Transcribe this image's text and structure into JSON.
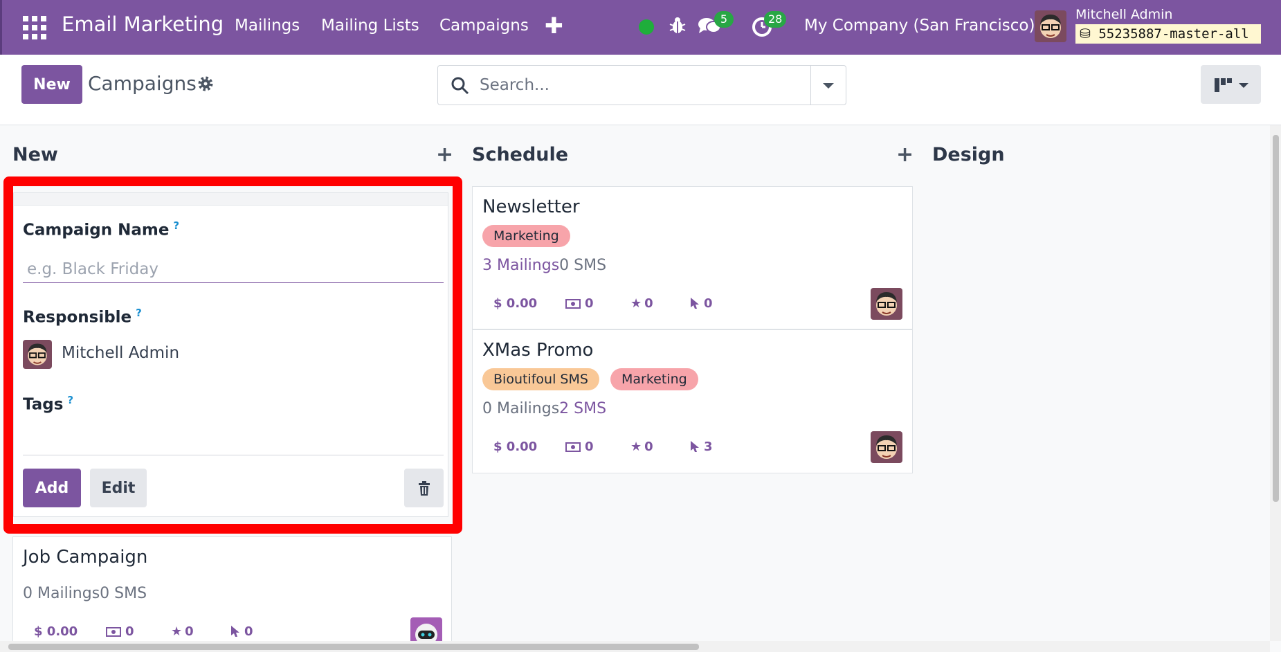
{
  "navbar": {
    "brand": "Email Marketing",
    "menu": [
      "Mailings",
      "Mailing Lists",
      "Campaigns"
    ],
    "chat_count": "5",
    "activity_count": "28",
    "company": "My Company (San Francisco)",
    "user_name": "Mitchell Admin",
    "database": "55235887-master-all",
    "colors": {
      "brand": "#7c55a0",
      "online": "#1fae3b",
      "badge": "#28a745"
    }
  },
  "control": {
    "new_label": "New",
    "breadcrumb": "Campaigns",
    "search_placeholder": "Search..."
  },
  "columns": [
    {
      "title": "New"
    },
    {
      "title": "Schedule"
    },
    {
      "title": "Design"
    }
  ],
  "quick_create": {
    "name_label": "Campaign Name",
    "name_placeholder": "e.g. Black Friday",
    "help_mark": "?",
    "responsible_label": "Responsible",
    "responsible_value": "Mitchell Admin",
    "tags_label": "Tags",
    "add_label": "Add",
    "edit_label": "Edit"
  },
  "cards": [
    {
      "title": "Job Campaign",
      "mailings": "0 Mailings",
      "sms": "0 SMS",
      "revenue": "$ 0.00",
      "quotations": "0",
      "opportunities": "0",
      "clicks": "0"
    },
    {
      "title": "Newsletter",
      "tags": [
        "Marketing"
      ],
      "mailings": "3 Mailings",
      "sms": "0 SMS",
      "revenue": "$ 0.00",
      "quotations": "0",
      "opportunities": "0",
      "clicks": "0"
    },
    {
      "title": "XMas Promo",
      "tags": [
        "Bioutifoul SMS",
        "Marketing"
      ],
      "mailings": "0 Mailings",
      "sms": "2 SMS",
      "revenue": "$ 0.00",
      "quotations": "0",
      "opportunities": "0",
      "clicks": "3"
    }
  ]
}
